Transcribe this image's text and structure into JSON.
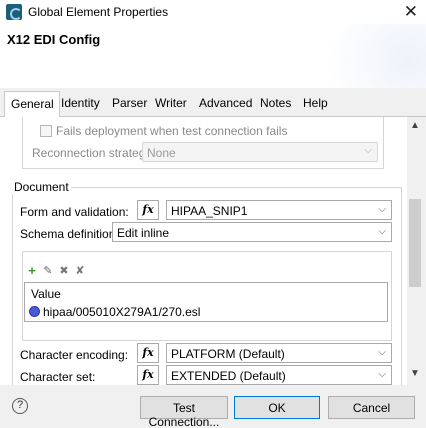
{
  "window": {
    "title": "Global Element Properties",
    "close_glyph": "✕"
  },
  "header": {
    "title": "X12 EDI Config"
  },
  "tabs": [
    {
      "label": "General",
      "active": true
    },
    {
      "label": "Identity"
    },
    {
      "label": "Parser"
    },
    {
      "label": "Writer"
    },
    {
      "label": "Advanced"
    },
    {
      "label": "Notes"
    },
    {
      "label": "Help"
    }
  ],
  "connection": {
    "fails_deployment_label": "Fails deployment when test connection fails",
    "fails_deployment_checked": false,
    "reconnection_label": "Reconnection strategy",
    "reconnection_value": "None"
  },
  "document": {
    "legend": "Document",
    "form_validation_label": "Form and validation:",
    "form_validation_value": "HIPAA_SNIP1",
    "schema_label": "Schema definitions",
    "schema_value": "Edit inline",
    "value_header": "Value",
    "schema_entries": [
      "hipaa/005010X279A1/270.esl"
    ],
    "char_encoding_label": "Character encoding:",
    "char_encoding_value": "PLATFORM (Default)",
    "char_set_label": "Character set:",
    "char_set_value": "EXTENDED (Default)"
  },
  "fx_label": "fx",
  "icons": {
    "add": "plus-icon",
    "edit": "edit-icon",
    "delete": "delete-icon",
    "clear": "clear-all-icon",
    "help": "help-icon",
    "esl": "schema-file-icon"
  },
  "footer": {
    "help_glyph": "?",
    "test_connection": "Test Connection...",
    "ok": "OK",
    "cancel": "Cancel"
  },
  "colors": {
    "accent": "#0078d7",
    "add_green": "#3c9a2a"
  }
}
